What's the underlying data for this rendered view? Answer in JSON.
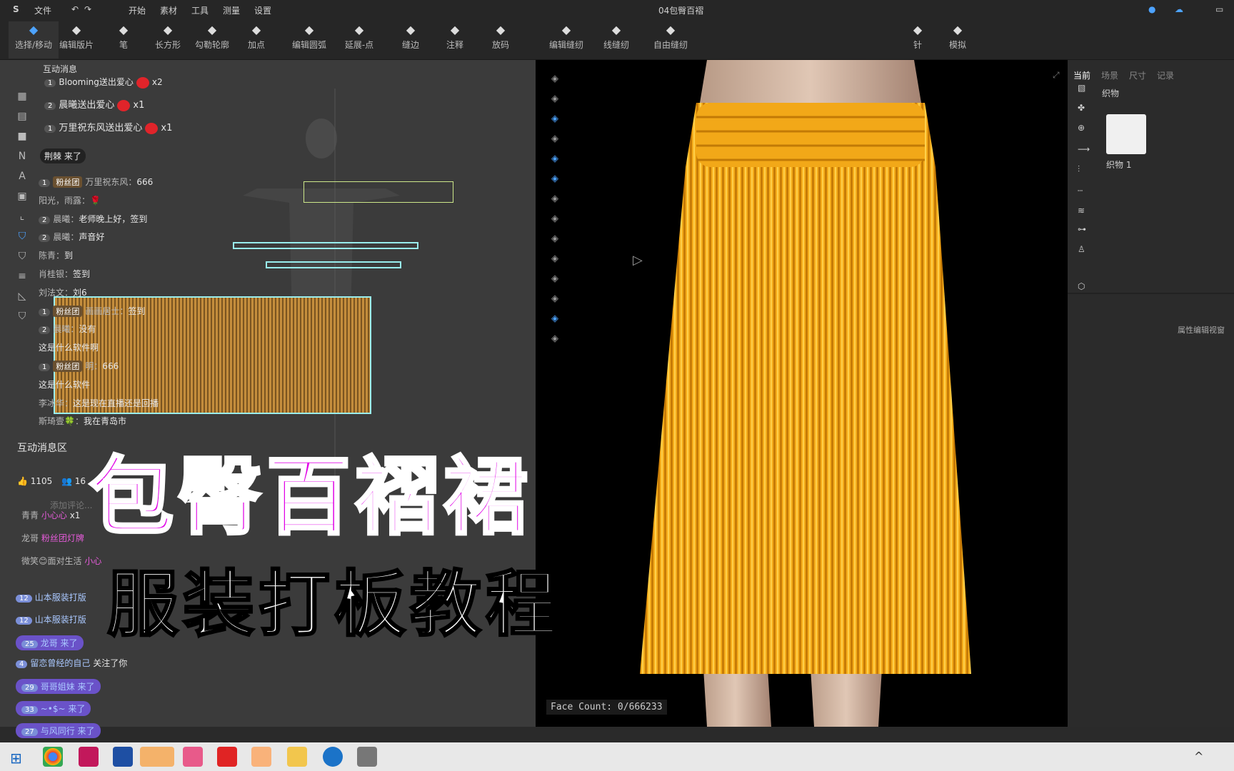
{
  "menubar": {
    "file": "文件",
    "start": "开始",
    "material": "素材",
    "tools": "工具",
    "measure": "测量",
    "settings": "设置",
    "title": "04包臀百褶"
  },
  "toolbar": {
    "tools": [
      {
        "label": "选择/移动",
        "icon": "cursor-icon"
      },
      {
        "label": "编辑版片",
        "icon": "edit-pattern-icon"
      },
      {
        "label": "笔",
        "icon": "pen-icon"
      },
      {
        "label": "长方形",
        "icon": "rectangle-icon"
      },
      {
        "label": "勾勒轮廓",
        "icon": "trace-icon"
      },
      {
        "label": "加点",
        "icon": "add-point-icon"
      },
      {
        "label": "编辑圆弧",
        "icon": "arc-icon"
      },
      {
        "label": "延展-点",
        "icon": "extend-icon"
      },
      {
        "label": "缝边",
        "icon": "seam-allowance-icon"
      },
      {
        "label": "注释",
        "icon": "annotation-icon"
      },
      {
        "label": "放码",
        "icon": "grading-icon"
      },
      {
        "label": "编辑缝纫",
        "icon": "edit-sewing-icon"
      },
      {
        "label": "线缝纫",
        "icon": "line-sewing-icon"
      },
      {
        "label": "自由缝纫",
        "icon": "free-sewing-icon"
      },
      {
        "label": "针",
        "icon": "needle-icon"
      },
      {
        "label": "模拟",
        "icon": "simulate-icon"
      }
    ]
  },
  "chat": {
    "header": "互动消息",
    "arrive": "荆棘 来了",
    "lines": [
      {
        "prefix": "1",
        "text": "Blooming送出爱心",
        "gift": "x2"
      },
      {
        "prefix": "2",
        "text": "晨曦送出爱心",
        "gift": "x1"
      },
      {
        "prefix": "1",
        "text": "万里祝东风送出爱心",
        "gift": "x1"
      }
    ],
    "messages": [
      {
        "badge": "1",
        "fans": "粉丝团",
        "user": "万里祝东风：",
        "text": "666"
      },
      {
        "user": "阳光，雨露：",
        "text": "🌹"
      },
      {
        "badge": "2",
        "user": "晨曦：",
        "text": "老师晚上好，签到"
      },
      {
        "badge": "2",
        "user": "晨曦：",
        "text": "声音好"
      },
      {
        "user": "陈青：",
        "text": "到"
      },
      {
        "user": "肖桂银：",
        "text": "签到"
      },
      {
        "user": "刘法文：",
        "text": "刘6"
      },
      {
        "badge": "1",
        "fans": "粉丝团",
        "user": "画画居士：",
        "text": "签到"
      },
      {
        "badge": "2",
        "user": "晨曦：",
        "text": "没有"
      },
      {
        "user": "",
        "text": "这是什么软件啊"
      },
      {
        "badge": "1",
        "fans": "粉丝团",
        "user": "明：",
        "text": "666"
      },
      {
        "user": "",
        "text": "这是什么软件"
      },
      {
        "user": "李冰华：",
        "text": "这是现在直播还是回播"
      },
      {
        "user": "斯琦壹🍀：",
        "text": "我在青岛市"
      }
    ],
    "zone_title": "互动消息区",
    "likes": "1105",
    "viewers": "16",
    "comment_placeholder": "添加评论...",
    "recent": [
      {
        "user": "青青",
        "text": "小心心",
        "extra": "x1"
      },
      {
        "user": "龙哥",
        "text": "粉丝团灯牌"
      },
      {
        "user": "微笑😊面对生活",
        "text": "小心"
      }
    ],
    "level_msgs": [
      {
        "level": "12",
        "text": "山本服装打版"
      },
      {
        "level": "12",
        "text": "山本服装打版"
      },
      {
        "level": "25",
        "text": "龙哥 来了"
      },
      {
        "level": "4",
        "text": "留恋曾经的自己",
        "extra": "关注了你"
      },
      {
        "level": "29",
        "text": "哥哥姐妹 来了"
      },
      {
        "level": "33",
        "text": "~•$~ 来了"
      },
      {
        "level": "27",
        "text": "与风同行 来了"
      }
    ]
  },
  "right": {
    "tabs": [
      "当前",
      "场景",
      "尺寸",
      "记录"
    ],
    "fabric_header": "织物",
    "fabric_name": "织物 1",
    "prop_header": "属性编辑视窗"
  },
  "viewport": {
    "face_count": "Face Count: 0/666233"
  },
  "overlay": {
    "line1": "包臀百褶裙",
    "line2": "服装打板教程"
  },
  "colors": {
    "skirt": "#f2a81a",
    "overlay_title": "#e000e6",
    "accent": "#4da3ff"
  }
}
